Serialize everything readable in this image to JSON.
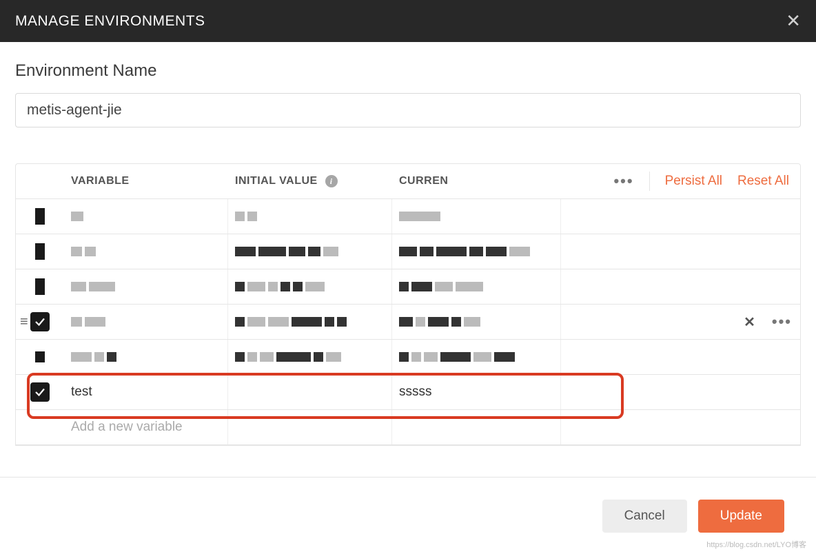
{
  "header": {
    "title": "MANAGE ENVIRONMENTS"
  },
  "env_name": {
    "label": "Environment Name",
    "value": "metis-agent-jie"
  },
  "table": {
    "columns": {
      "variable": "VARIABLE",
      "initial": "INITIAL VALUE",
      "current": "CURREN"
    },
    "actions": {
      "persist": "Persist All",
      "reset": "Reset All"
    },
    "highlighted_row": {
      "checked": true,
      "variable": "test",
      "initial": "",
      "current": "sssss"
    },
    "add_placeholder": "Add a new variable"
  },
  "footer": {
    "cancel": "Cancel",
    "update": "Update"
  },
  "watermark": "https://blog.csdn.net/LYO博客"
}
